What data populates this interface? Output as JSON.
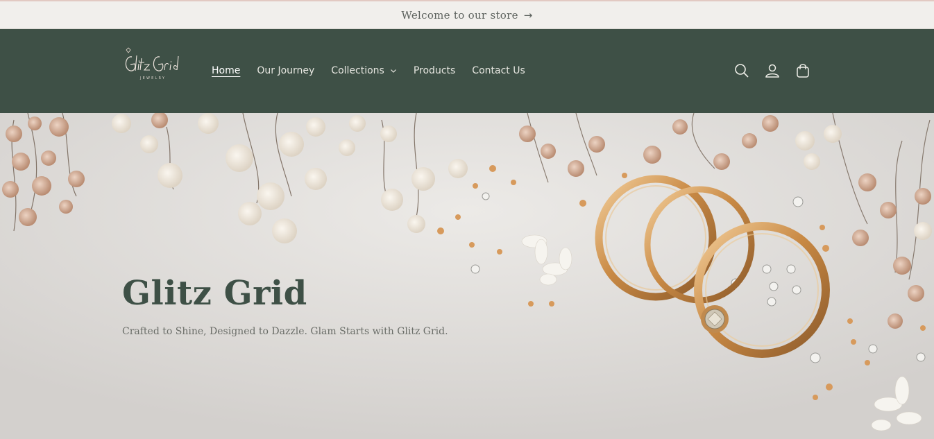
{
  "announcement": {
    "text": "Welcome to our store",
    "arrow_icon": "arrow-right-icon"
  },
  "header": {
    "logo_text": "GlitzGrid",
    "logo_subtext": "JEWELRY",
    "nav": [
      {
        "label": "Home",
        "active": true
      },
      {
        "label": "Our Journey"
      },
      {
        "label": "Collections",
        "has_dropdown": true
      },
      {
        "label": "Products"
      },
      {
        "label": "Contact Us"
      }
    ],
    "icons": [
      "search-icon",
      "account-icon",
      "cart-icon"
    ]
  },
  "hero": {
    "title": "Glitz Grid",
    "subtitle": "Crafted to Shine, Designed to Dazzle. Glam Starts with Glitz Grid."
  },
  "colors": {
    "header_bg": "#3e5046",
    "announcement_bg": "#f1efec",
    "title": "#3e5046"
  }
}
